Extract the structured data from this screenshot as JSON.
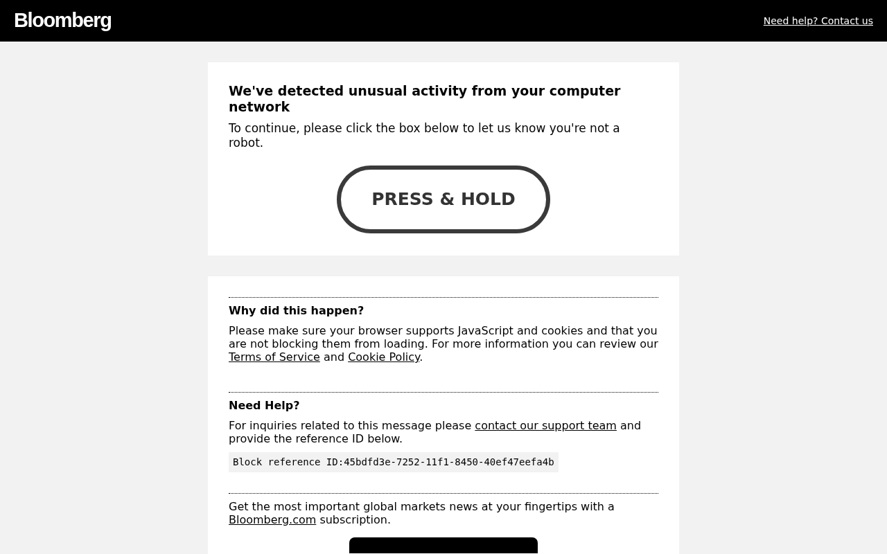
{
  "header": {
    "logo": "Bloomberg",
    "help_link": "Need help? Contact us"
  },
  "challenge": {
    "title": "We've detected unusual activity from your computer network",
    "message": "To continue, please click the box below to let us know you're not a robot.",
    "button": "PRESS & HOLD"
  },
  "sections": [
    {
      "heading": "Why did this happen?",
      "paragraph": [
        {
          "kind": "text",
          "text": "Please make sure your browser supports JavaScript and cookies and that you are not blocking them from loading. For more information you can review our "
        },
        {
          "kind": "link",
          "text": "Terms of Service"
        },
        {
          "kind": "text",
          "text": " and "
        },
        {
          "kind": "link",
          "text": "Cookie Policy"
        },
        {
          "kind": "text",
          "text": "."
        }
      ]
    },
    {
      "heading": "Need Help?",
      "paragraph": [
        {
          "kind": "text",
          "text": "For inquiries related to this message please "
        },
        {
          "kind": "link",
          "text": "contact our support team"
        },
        {
          "kind": "text",
          "text": " and provide the reference ID below."
        }
      ],
      "reference": "Block reference ID:45bdfd3e-7252-11f1-8450-40ef47eefa4b"
    },
    {
      "paragraph": [
        {
          "kind": "text",
          "text": "Get the most important global markets news at your fingertips with a "
        },
        {
          "kind": "link",
          "text": "Bloomberg.com"
        },
        {
          "kind": "text",
          "text": " subscription."
        }
      ],
      "has_button": true
    }
  ]
}
